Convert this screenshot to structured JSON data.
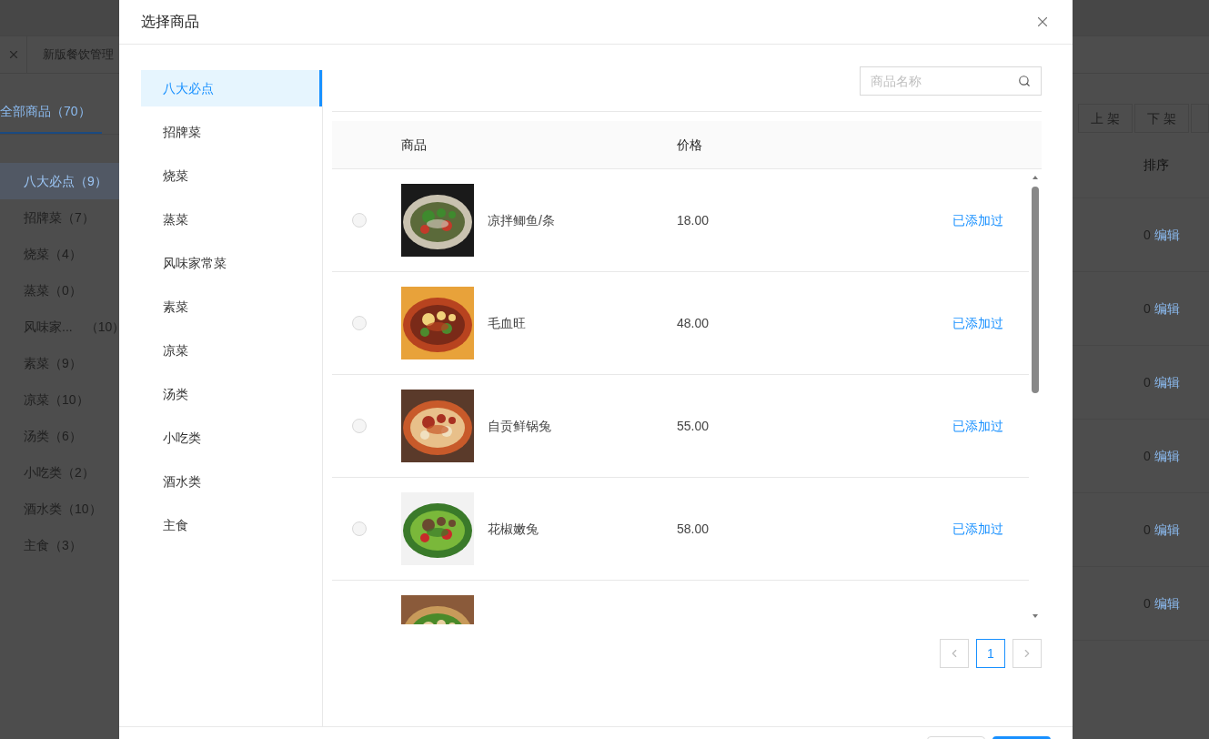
{
  "background": {
    "page_tab": {
      "label": "新版餐饮管理"
    },
    "category_tab": {
      "label": "全部商品（70）",
      "selected": true
    },
    "categories": [
      {
        "name": "八大必点",
        "count": "（9）",
        "selected": true
      },
      {
        "name": "招牌菜",
        "count": "（7）",
        "selected": false
      },
      {
        "name": "烧菜",
        "count": "（4）",
        "selected": false
      },
      {
        "name": "蒸菜",
        "count": "（0）",
        "selected": false
      },
      {
        "name": "风味家...",
        "count": "（10）",
        "selected": false
      },
      {
        "name": "素菜",
        "count": "（9）",
        "selected": false
      },
      {
        "name": "凉菜",
        "count": "（10）",
        "selected": false
      },
      {
        "name": "汤类",
        "count": "（6）",
        "selected": false
      },
      {
        "name": "小吃类",
        "count": "（2）",
        "selected": false
      },
      {
        "name": "酒水类",
        "count": "（10）",
        "selected": false
      },
      {
        "name": "主食",
        "count": "（3）",
        "selected": false
      }
    ],
    "toolbar_buttons": [
      "上 架",
      "下 架"
    ],
    "column_header": "排序",
    "rows": [
      {
        "sort": "0",
        "action": "编辑"
      },
      {
        "sort": "0",
        "action": "编辑"
      },
      {
        "sort": "0",
        "action": "编辑"
      },
      {
        "sort": "0",
        "action": "编辑"
      },
      {
        "sort": "0",
        "action": "编辑"
      },
      {
        "sort": "0",
        "action": "编辑"
      }
    ]
  },
  "dialog": {
    "title": "选择商品",
    "categories": [
      {
        "label": "八大必点",
        "selected": true
      },
      {
        "label": "招牌菜",
        "selected": false
      },
      {
        "label": "烧菜",
        "selected": false
      },
      {
        "label": "蒸菜",
        "selected": false
      },
      {
        "label": "风味家常菜",
        "selected": false
      },
      {
        "label": "素菜",
        "selected": false
      },
      {
        "label": "凉菜",
        "selected": false
      },
      {
        "label": "汤类",
        "selected": false
      },
      {
        "label": "小吃类",
        "selected": false
      },
      {
        "label": "酒水类",
        "selected": false
      },
      {
        "label": "主食",
        "selected": false
      }
    ],
    "search": {
      "placeholder": "商品名称"
    },
    "table": {
      "columns": [
        "商品",
        "价格"
      ],
      "rows": [
        {
          "name": "凉拌鲫鱼/条",
          "price": "18.00",
          "status": "已添加过",
          "selected": false
        },
        {
          "name": "毛血旺",
          "price": "48.00",
          "status": "已添加过",
          "selected": false
        },
        {
          "name": "自贡鲜锅兔",
          "price": "55.00",
          "status": "已添加过",
          "selected": false
        },
        {
          "name": "花椒嫩兔",
          "price": "58.00",
          "status": "已添加过",
          "selected": false
        }
      ]
    },
    "pagination": {
      "pages": [
        {
          "label": "1",
          "selected": true
        }
      ]
    }
  }
}
